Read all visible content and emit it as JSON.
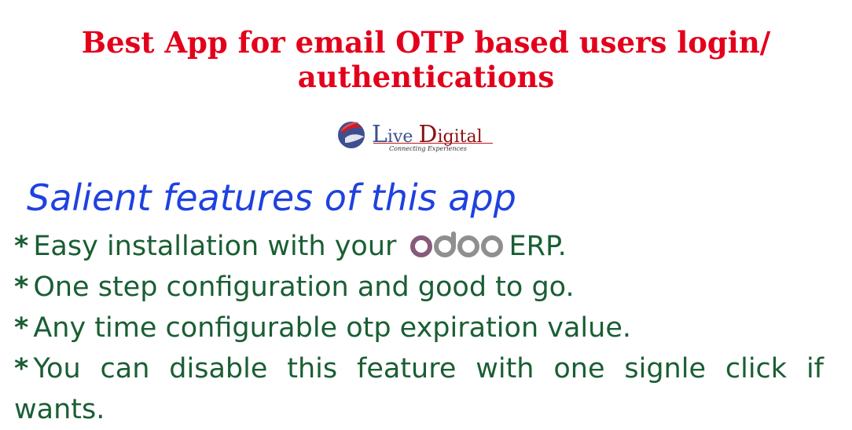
{
  "headline": {
    "line1": "Best App for email OTP based users login/",
    "line2": "authentications"
  },
  "logo": {
    "brand_first_initial": "L",
    "brand_first_rest": "ive",
    "brand_second_initial": "D",
    "brand_second_rest": "igital",
    "tagline": "Connecting Experiences",
    "colors": {
      "blue": "#3d4f8f",
      "red": "#8b0f12",
      "accent": "#c0171c"
    }
  },
  "section_title": "Salient features of this app",
  "features": {
    "bullet": "*",
    "item1_before": "Easy installation with your",
    "item1_logo": "odoo",
    "item1_after": "ERP.",
    "item2": "One step configuration and good to go.",
    "item3": "Any time configurable otp expiration value.",
    "item4": "You can disable this feature with one signle click if wants."
  },
  "colors": {
    "headline": "#e3001b",
    "section_title": "#1f41e0",
    "feature_text": "#1a5e34",
    "odoo_purple": "#875a7b",
    "odoo_grey": "#8f8f8f"
  }
}
